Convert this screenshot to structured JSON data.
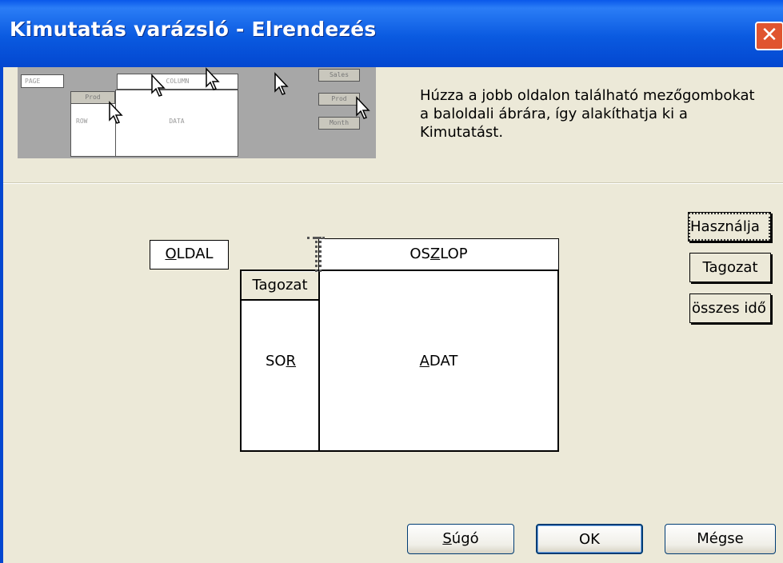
{
  "window": {
    "title": "Kimutatás varázsló - Elrendezés",
    "close_glyph": "✕"
  },
  "preview": {
    "page_label": "PAGE",
    "column_label": "COLUMN",
    "row_label": "ROW",
    "data_label": "DATA",
    "prod_label": "Prod",
    "fields": [
      "Sales",
      "Prod",
      "Month"
    ]
  },
  "instructions": "Húzza a jobb oldalon található mezőgombokat a baloldali ábrára, így alakíthatja ki a Kimutatást.",
  "layout": {
    "page_area": {
      "pre": "",
      "accel": "O",
      "post": "LDAL"
    },
    "column_area": {
      "pre": "OS",
      "accel": "Z",
      "post": "LOP"
    },
    "row_area": {
      "pre": "SO",
      "accel": "R",
      "post": ""
    },
    "data_area": {
      "pre": "",
      "accel": "A",
      "post": "DAT"
    },
    "row_field": "Tagozat"
  },
  "fields": [
    "Használja",
    "Tagozat",
    "összes idő"
  ],
  "buttons": {
    "help": {
      "pre": "",
      "accel": "S",
      "post": "úgó"
    },
    "ok": "OK",
    "cancel": "Mégse"
  }
}
